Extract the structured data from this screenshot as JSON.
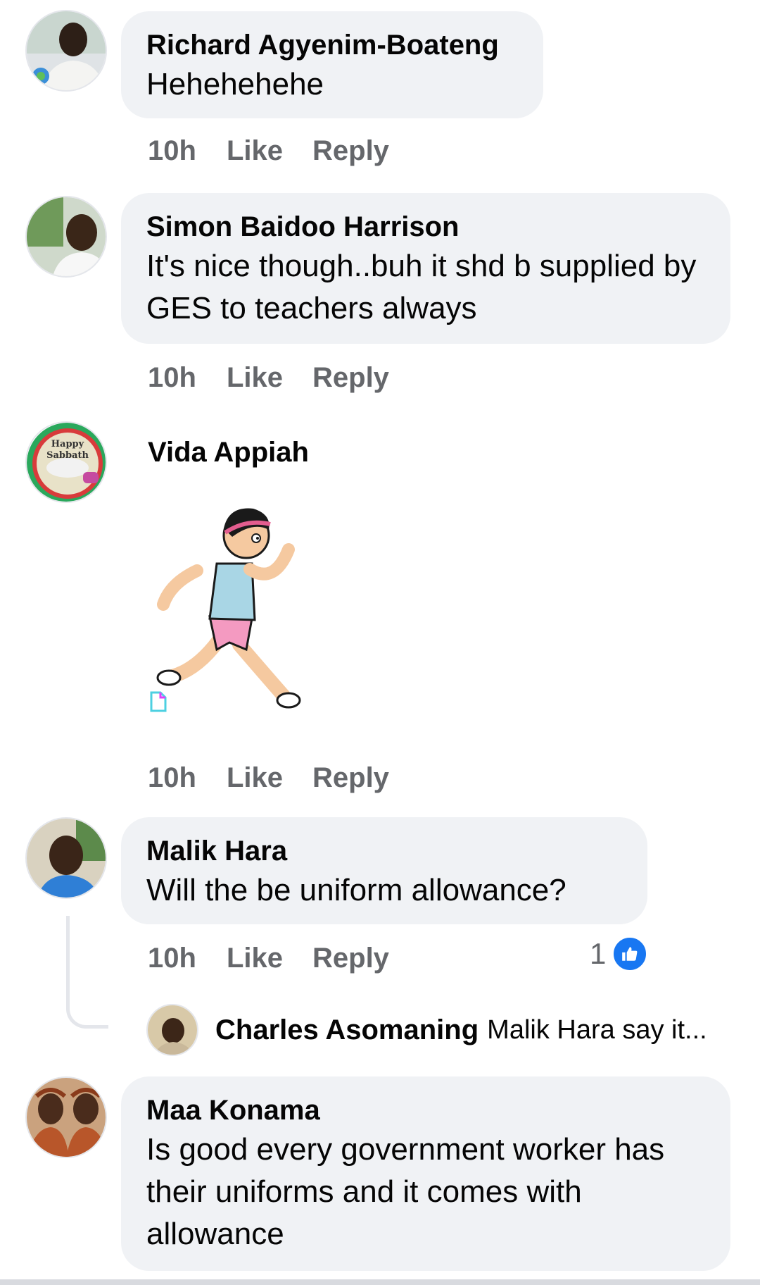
{
  "comments": [
    {
      "name": "Richard Agyenim-Boateng",
      "text": "Hehehehehe",
      "time": "10h",
      "like_label": "Like",
      "reply_label": "Reply"
    },
    {
      "name": "Simon Baidoo Harrison",
      "text": "It's nice though..buh it shd b supplied by GES to teachers always",
      "time": "10h",
      "like_label": "Like",
      "reply_label": "Reply"
    },
    {
      "name": "Vida Appiah",
      "avatar_text_top": "Happy",
      "avatar_text_bottom": "Sabbath",
      "time": "10h",
      "like_label": "Like",
      "reply_label": "Reply"
    },
    {
      "name": "Malik Hara",
      "text": "Will the be uniform allowance?",
      "time": "10h",
      "like_label": "Like",
      "reply_label": "Reply",
      "reaction_count": "1"
    },
    {
      "name": "Maa Konama",
      "text": "Is good every government worker has their uniforms and it comes with allowance"
    }
  ],
  "reply_preview": {
    "name": "Charles Asomaning",
    "text": "Malik Hara say it..."
  },
  "colors": {
    "bubble": "#f0f2f5",
    "meta": "#65676b",
    "like_blue": "#1877f2"
  }
}
